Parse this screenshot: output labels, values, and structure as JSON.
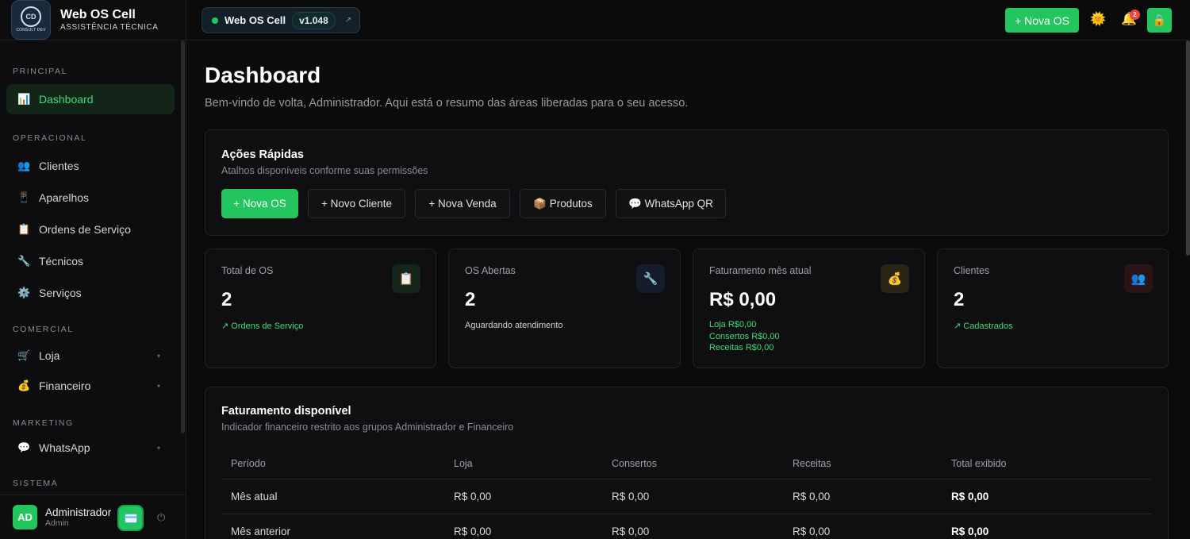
{
  "brand": {
    "logo_text": "CD",
    "logo_sub": "CONSULT DEV",
    "name": "Web OS Cell",
    "subtitle": "ASSISTÊNCIA TÉCNICA"
  },
  "version": {
    "title": "Web OS Cell",
    "tag": "v1.048"
  },
  "topbar": {
    "new_os": "+ Nova OS",
    "notifications": "2"
  },
  "sidebar": {
    "sections": [
      "PRINCIPAL",
      "OPERACIONAL",
      "COMERCIAL",
      "MARKETING",
      "SISTEMA"
    ],
    "items": [
      {
        "label": "Dashboard",
        "icon": "bar-chart-icon"
      },
      {
        "label": "Clientes",
        "icon": "users-icon"
      },
      {
        "label": "Aparelhos",
        "icon": "phone-icon"
      },
      {
        "label": "Ordens de Serviço",
        "icon": "clipboard-icon"
      },
      {
        "label": "Técnicos",
        "icon": "wrench-icon"
      },
      {
        "label": "Serviços",
        "icon": "gear-icon"
      },
      {
        "label": "Loja",
        "icon": "cart-icon"
      },
      {
        "label": "Financeiro",
        "icon": "money-bag-icon"
      },
      {
        "label": "WhatsApp",
        "icon": "chat-icon"
      }
    ]
  },
  "user": {
    "initials": "AD",
    "name": "Administrador",
    "role": "Admin"
  },
  "page": {
    "title": "Dashboard",
    "subtitle": "Bem-vindo de volta, Administrador. Aqui está o resumo das áreas liberadas para o seu acesso."
  },
  "quick_actions": {
    "title": "Ações Rápidas",
    "subtitle": "Atalhos disponíveis conforme suas permissões",
    "buttons": [
      "+ Nova OS",
      "+ Novo Cliente",
      "+ Nova Venda",
      "📦 Produtos",
      "💬 WhatsApp QR"
    ]
  },
  "stats": [
    {
      "label": "Total de OS",
      "value": "2",
      "note": "↗ Ordens de Serviço",
      "icon": "clipboard-icon"
    },
    {
      "label": "OS Abertas",
      "value": "2",
      "note": "Aguardando atendimento",
      "icon": "wrench-icon"
    },
    {
      "label": "Faturamento mês atual",
      "value": "R$ 0,00",
      "lines": [
        "Loja R$0,00",
        "Consertos R$0,00",
        "Receitas R$0,00"
      ],
      "icon": "money-bag-icon"
    },
    {
      "label": "Clientes",
      "value": "2",
      "note": "↗ Cadastrados",
      "icon": "users-icon"
    }
  ],
  "billing": {
    "title": "Faturamento disponível",
    "subtitle": "Indicador financeiro restrito aos grupos Administrador e Financeiro",
    "columns": [
      "Período",
      "Loja",
      "Consertos",
      "Receitas",
      "Total exibido"
    ],
    "rows": [
      [
        "Mês atual",
        "R$ 0,00",
        "R$ 0,00",
        "R$ 0,00",
        "R$ 0,00"
      ],
      [
        "Mês anterior",
        "R$ 0,00",
        "R$ 0,00",
        "R$ 0,00",
        "R$ 0,00"
      ]
    ]
  },
  "colors": {
    "accent": "#22c55e",
    "background": "#0b0b0c",
    "panel": "#0f0f11"
  }
}
